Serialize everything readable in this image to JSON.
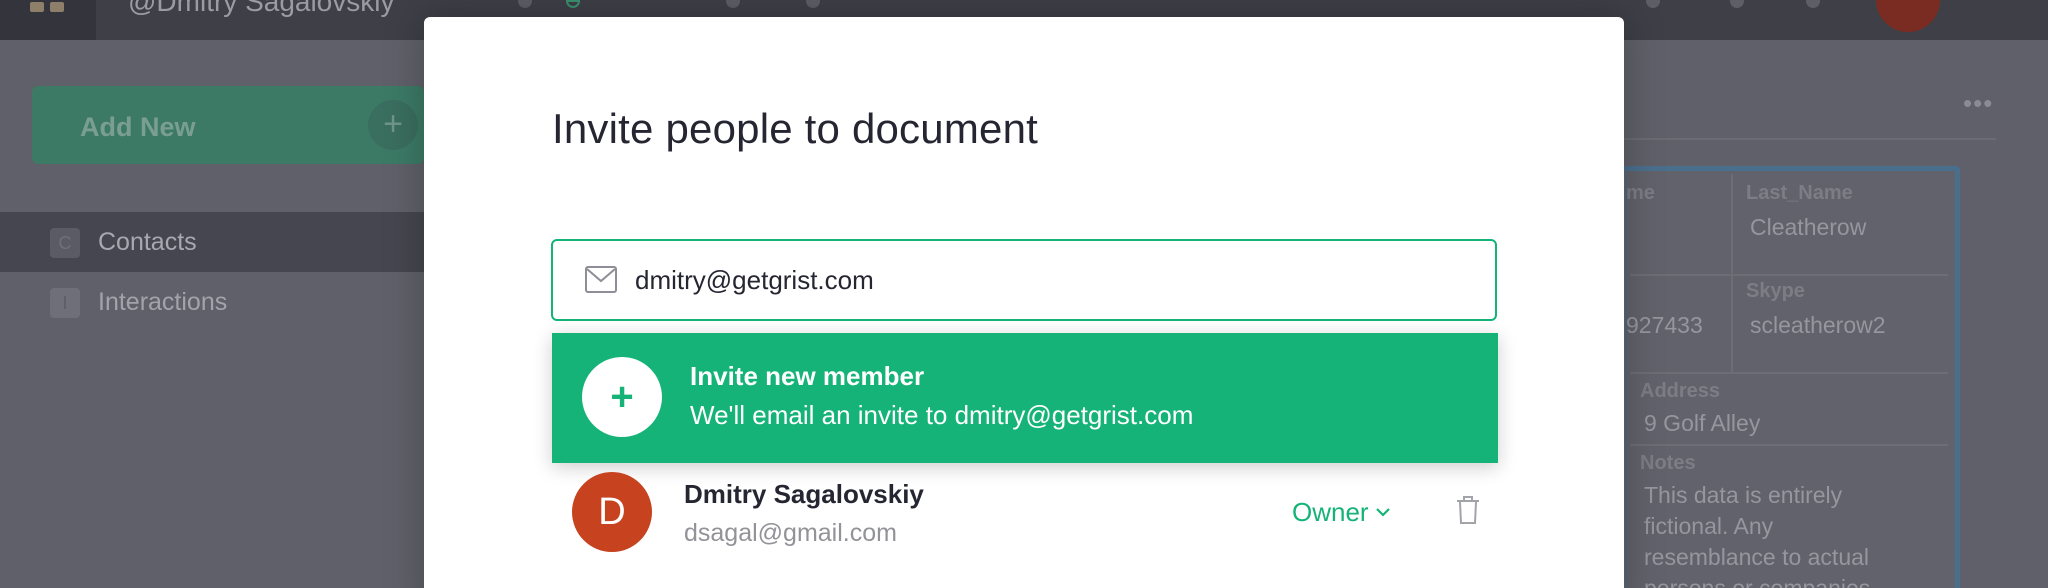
{
  "app": {
    "topbar": {
      "user_name": "@Dmitry Sagalovskiy"
    },
    "sidebar": {
      "add_new_label": "Add New",
      "add_new_icon": "plus-icon",
      "items": [
        {
          "icon_letter": "C",
          "label": "Contacts",
          "active": true
        },
        {
          "icon_letter": "I",
          "label": "Interactions",
          "active": false
        }
      ]
    },
    "card": {
      "col1_header": "me",
      "last_name_label": "Last_Name",
      "last_name_value": "Cleatherow",
      "phone_value": "927433",
      "skype_label": "Skype",
      "skype_value": "scleatherow2",
      "address_label": "Address",
      "address_value": "9 Golf Alley",
      "notes_label": "Notes",
      "notes_line1": "This data is entirely",
      "notes_line2": "fictional. Any",
      "notes_line3": "resemblance to actual",
      "notes_line4": "persons or companies"
    }
  },
  "modal": {
    "title": "Invite people to document",
    "email_input": {
      "value": "dmitry@getgrist.com",
      "icon": "mail-icon"
    },
    "suggestion": {
      "title": "Invite new member",
      "subtitle": "We'll email an invite to dmitry@getgrist.com",
      "icon": "plus-icon"
    },
    "members": [
      {
        "initial": "D",
        "name": "Dmitry Sagalovskiy",
        "email": "dsagal@gmail.com",
        "role": "Owner"
      }
    ]
  },
  "colors": {
    "accent": "#16b378",
    "avatar": "#c7431f",
    "title_text": "#262633",
    "muted_text": "#929299"
  }
}
